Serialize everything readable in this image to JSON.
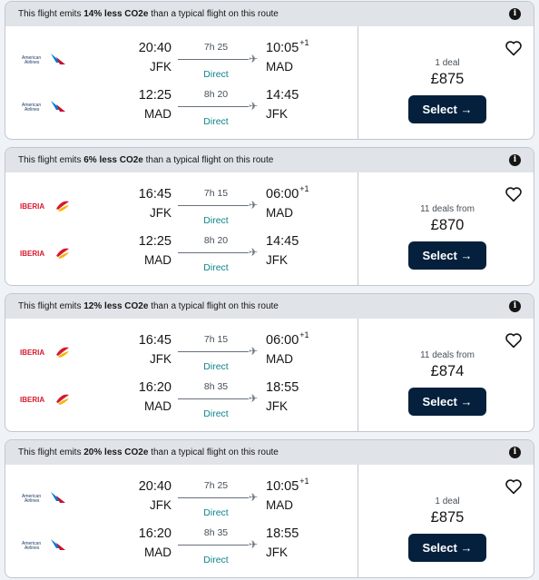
{
  "colors": {
    "page_bg": "#eff3f8",
    "eco_bar_bg": "#e0e4e9",
    "select_bg": "#05203c",
    "direct_text": "#0c838a",
    "aa_red": "#c8102e",
    "aa_blue": "#0078d2",
    "iberia_red": "#d7192d",
    "iberia_yellow": "#f7b500"
  },
  "results": [
    {
      "eco_prefix": "This flight emits ",
      "eco_pct": "14% less CO2e",
      "eco_suffix": " than a typical flight on this route",
      "deals": "1 deal",
      "price": "£875",
      "select_label": "Select →",
      "legs": [
        {
          "airline": "American Airlines",
          "logo": "american-airlines-logo",
          "logo_line1": "American",
          "logo_line2": "Airlines",
          "dep_time": "20:40",
          "dep_code": "JFK",
          "duration": "7h 25",
          "stops": "Direct",
          "arr_time": "10:05",
          "arr_plus": "+1",
          "arr_code": "MAD"
        },
        {
          "airline": "American Airlines",
          "logo": "american-airlines-logo",
          "logo_line1": "American",
          "logo_line2": "Airlines",
          "dep_time": "12:25",
          "dep_code": "MAD",
          "duration": "8h 20",
          "stops": "Direct",
          "arr_time": "14:45",
          "arr_plus": "",
          "arr_code": "JFK"
        }
      ]
    },
    {
      "eco_prefix": "This flight emits ",
      "eco_pct": "6% less CO2e",
      "eco_suffix": " than a typical flight on this route",
      "deals": "11 deals from",
      "price": "£870",
      "select_label": "Select →",
      "legs": [
        {
          "airline": "Iberia",
          "logo": "iberia-logo",
          "logo_text": "IBERIA",
          "dep_time": "16:45",
          "dep_code": "JFK",
          "duration": "7h 15",
          "stops": "Direct",
          "arr_time": "06:00",
          "arr_plus": "+1",
          "arr_code": "MAD"
        },
        {
          "airline": "Iberia",
          "logo": "iberia-logo",
          "logo_text": "IBERIA",
          "dep_time": "12:25",
          "dep_code": "MAD",
          "duration": "8h 20",
          "stops": "Direct",
          "arr_time": "14:45",
          "arr_plus": "",
          "arr_code": "JFK"
        }
      ]
    },
    {
      "eco_prefix": "This flight emits ",
      "eco_pct": "12% less CO2e",
      "eco_suffix": " than a typical flight on this route",
      "deals": "11 deals from",
      "price": "£874",
      "select_label": "Select →",
      "legs": [
        {
          "airline": "Iberia",
          "logo": "iberia-logo",
          "logo_text": "IBERIA",
          "dep_time": "16:45",
          "dep_code": "JFK",
          "duration": "7h 15",
          "stops": "Direct",
          "arr_time": "06:00",
          "arr_plus": "+1",
          "arr_code": "MAD"
        },
        {
          "airline": "Iberia",
          "logo": "iberia-logo",
          "logo_text": "IBERIA",
          "dep_time": "16:20",
          "dep_code": "MAD",
          "duration": "8h 35",
          "stops": "Direct",
          "arr_time": "18:55",
          "arr_plus": "",
          "arr_code": "JFK"
        }
      ]
    },
    {
      "eco_prefix": "This flight emits ",
      "eco_pct": "20% less CO2e",
      "eco_suffix": " than a typical flight on this route",
      "deals": "1 deal",
      "price": "£875",
      "select_label": "Select →",
      "legs": [
        {
          "airline": "American Airlines",
          "logo": "american-airlines-logo",
          "logo_line1": "American",
          "logo_line2": "Airlines",
          "dep_time": "20:40",
          "dep_code": "JFK",
          "duration": "7h 25",
          "stops": "Direct",
          "arr_time": "10:05",
          "arr_plus": "+1",
          "arr_code": "MAD"
        },
        {
          "airline": "American Airlines",
          "logo": "american-airlines-logo",
          "logo_line1": "American",
          "logo_line2": "Airlines",
          "dep_time": "16:20",
          "dep_code": "MAD",
          "duration": "8h 35",
          "stops": "Direct",
          "arr_time": "18:55",
          "arr_plus": "",
          "arr_code": "JFK"
        }
      ]
    }
  ],
  "icons": {
    "info": "info-icon",
    "heart": "heart-outline-icon",
    "plane": "plane-icon",
    "arrow": "arrow-right-icon"
  }
}
